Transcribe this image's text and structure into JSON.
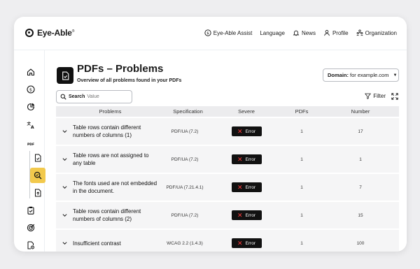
{
  "app": {
    "name": "Eye-Able",
    "trademark": "®"
  },
  "nav": [
    {
      "label": "Eye-Able Assist",
      "icon": "dollar-circle-icon"
    },
    {
      "label": "Language",
      "icon": ""
    },
    {
      "label": "News",
      "icon": "bell-icon"
    },
    {
      "label": "Profile",
      "icon": "user-icon"
    },
    {
      "label": "Organization",
      "icon": "organization-icon"
    }
  ],
  "sidebar": {
    "items": [
      {
        "icon": "home-icon"
      },
      {
        "icon": "dollar-circle-icon"
      },
      {
        "icon": "pie-chart-icon"
      },
      {
        "icon": "translate-icon"
      },
      {
        "icon": "pdf-document-icon"
      },
      {
        "icon": "document-check-icon"
      },
      {
        "icon": "search-document-icon",
        "active": true
      },
      {
        "icon": "document-upload-icon"
      },
      {
        "icon": "clipboard-check-icon"
      },
      {
        "icon": "target-icon"
      },
      {
        "icon": "file-settings-icon"
      }
    ],
    "active_color": "#f2c94c"
  },
  "page": {
    "title": "PDFs – Problems",
    "subtitle": "Overview of all problems found in your PDFs"
  },
  "domain": {
    "label": "Domain:",
    "value": "for example.com"
  },
  "search": {
    "label": "Search",
    "placeholder": "Value"
  },
  "filter": {
    "label": "Filter"
  },
  "table": {
    "headers": {
      "problems": "Problems",
      "specification": "Specification",
      "severe": "Severe",
      "pdfs": "PDFs",
      "number": "Number"
    },
    "rows": [
      {
        "problem": "Table rows contain different numbers of columns (1)",
        "spec": "PDF/UA (7.2)",
        "severe": "Error",
        "pdfs": "1",
        "number": "17"
      },
      {
        "problem": "Table rows are not assigned to any table",
        "spec": "PDF/UA (7.2)",
        "severe": "Error",
        "pdfs": "1",
        "number": "1"
      },
      {
        "problem": "The fonts used are not embedded in the document.",
        "spec": "PDF/UA (7.21.4.1)",
        "severe": "Error",
        "pdfs": "1",
        "number": "7"
      },
      {
        "problem": "Table rows contain different numbers of columns (2)",
        "spec": "PDF/UA (7.2)",
        "severe": "Error",
        "pdfs": "1",
        "number": "15"
      },
      {
        "problem": "Insufficient contrast",
        "spec": "WCAG 2.2 (1.4.3)",
        "severe": "Error",
        "pdfs": "1",
        "number": "100"
      }
    ]
  },
  "colors": {
    "error_badge": "#111111",
    "error_x": "#ff3b3b",
    "table_row": "#f5f5f6",
    "table_header": "#ececee"
  }
}
